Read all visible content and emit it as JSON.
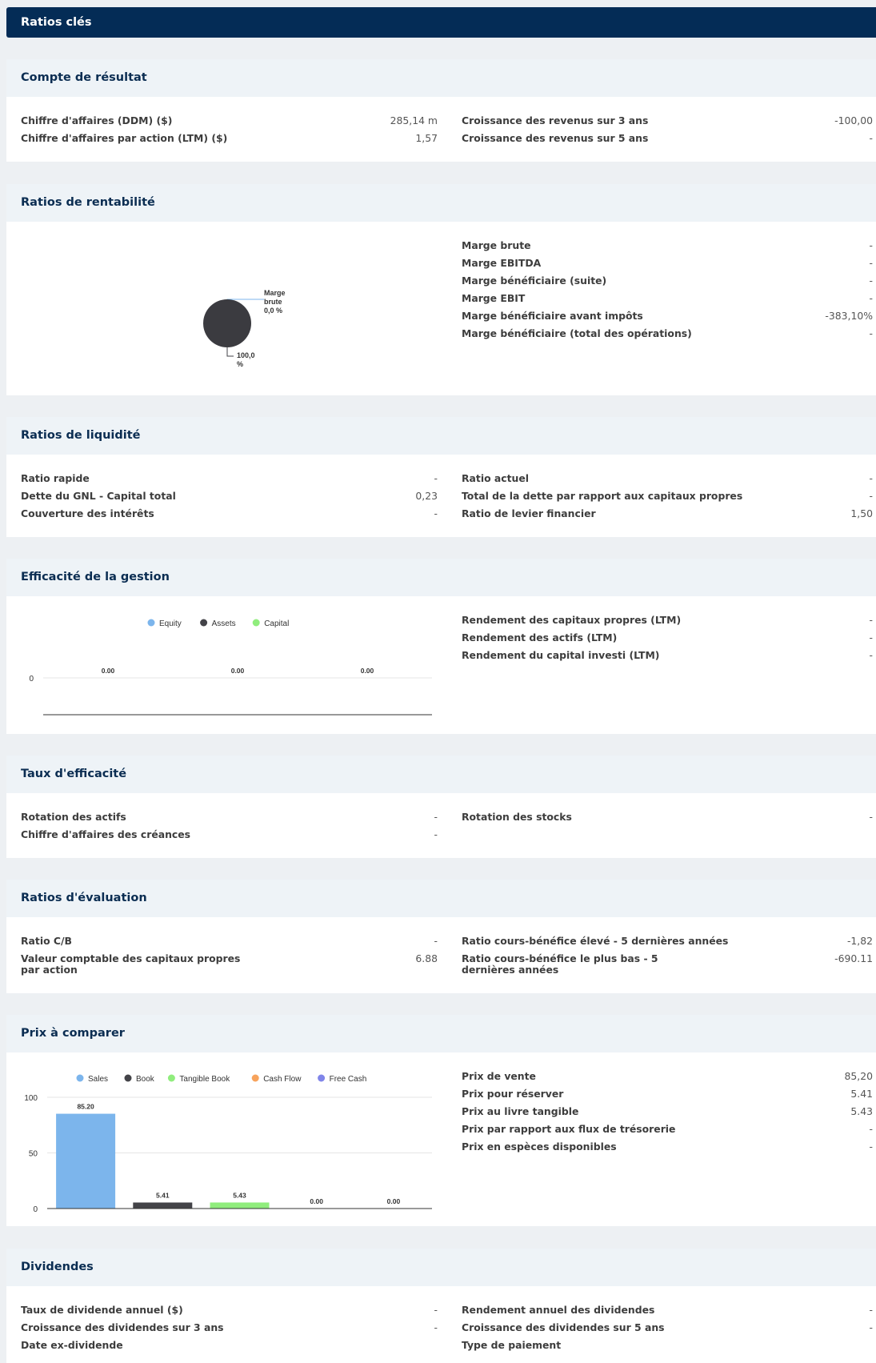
{
  "header": {
    "title": "Ratios clés"
  },
  "income": {
    "title": "Compte de résultat",
    "left": [
      {
        "label": "Chiffre d'affaires (DDM) ($)",
        "value": "285,14 m"
      },
      {
        "label": "Chiffre d'affaires par action (LTM) ($)",
        "value": "1,57"
      }
    ],
    "right": [
      {
        "label": "Croissance des revenus sur 3 ans",
        "value": "-100,00"
      },
      {
        "label": "Croissance des revenus sur 5 ans",
        "value": "-"
      }
    ]
  },
  "profitability": {
    "title": "Ratios de rentabilité",
    "pie_label_top": [
      "Marge",
      "brute",
      "0,0 %"
    ],
    "pie_label_bottom": [
      "100,0",
      "%"
    ],
    "right": [
      {
        "label": "Marge brute",
        "value": "-"
      },
      {
        "label": "Marge EBITDA",
        "value": "-"
      },
      {
        "label": "Marge bénéficiaire (suite)",
        "value": "-"
      },
      {
        "label": "Marge EBIT",
        "value": "-"
      },
      {
        "label": "Marge bénéficiaire avant impôts",
        "value": "-383,10%"
      },
      {
        "label": "Marge bénéficiaire (total des opérations)",
        "value": "-"
      }
    ]
  },
  "liquidity": {
    "title": "Ratios de liquidité",
    "left": [
      {
        "label": "Ratio rapide",
        "value": "-"
      },
      {
        "label": "Dette du GNL - Capital total",
        "value": "0,23"
      },
      {
        "label": "Couverture des intérêts",
        "value": "-"
      }
    ],
    "right": [
      {
        "label": "Ratio actuel",
        "value": "-"
      },
      {
        "label": "Total de la dette par rapport aux capitaux propres",
        "value": "-"
      },
      {
        "label": "Ratio de levier financier",
        "value": "1,50"
      }
    ]
  },
  "management": {
    "title": "Efficacité de la gestion",
    "right": [
      {
        "label": "Rendement des capitaux propres (LTM)",
        "value": "-"
      },
      {
        "label": "Rendement des actifs (LTM)",
        "value": "-"
      },
      {
        "label": "Rendement du capital investi (LTM)",
        "value": "-"
      }
    ]
  },
  "efficiency": {
    "title": "Taux d'efficacité",
    "left": [
      {
        "label": "Rotation des actifs",
        "value": "-"
      },
      {
        "label": "Chiffre d'affaires des créances",
        "value": "-"
      }
    ],
    "right": [
      {
        "label": "Rotation des stocks",
        "value": "-"
      }
    ]
  },
  "valuation": {
    "title": "Ratios d'évaluation",
    "left": [
      {
        "label": "Ratio C/B",
        "value": "-"
      },
      {
        "label": "Valeur comptable des capitaux propres par action",
        "value": "6.88"
      }
    ],
    "right": [
      {
        "label": "Ratio cours-bénéfice élevé - 5 dernières années",
        "value": "-1,82"
      },
      {
        "label": "Ratio cours-bénéfice le plus bas - 5 dernières années",
        "value": "-690.11"
      }
    ]
  },
  "prices": {
    "title": "Prix à comparer",
    "right": [
      {
        "label": "Prix de vente",
        "value": "85,20"
      },
      {
        "label": "Prix pour réserver",
        "value": "5.41"
      },
      {
        "label": "Prix au livre tangible",
        "value": "5.43"
      },
      {
        "label": "Prix par rapport aux flux de trésorerie",
        "value": "-"
      },
      {
        "label": "Prix en espèces disponibles",
        "value": "-"
      }
    ]
  },
  "dividends": {
    "title": "Dividendes",
    "left": [
      {
        "label": "Taux de dividende annuel ($)",
        "value": "-"
      },
      {
        "label": "Croissance des dividendes sur 3 ans",
        "value": "-"
      },
      {
        "label": "Date ex-dividende",
        "value": ""
      }
    ],
    "right": [
      {
        "label": "Rendement annuel des dividendes",
        "value": "-"
      },
      {
        "label": "Croissance des dividendes sur 5 ans",
        "value": "-"
      },
      {
        "label": "Type de paiement",
        "value": ""
      }
    ]
  },
  "chart_data": [
    {
      "type": "pie",
      "slices": [
        {
          "label": "Marge brute",
          "value": 0.0
        },
        {
          "label": "",
          "value": 100.0
        }
      ],
      "colors": [
        "#3b3b40"
      ]
    },
    {
      "type": "bar",
      "legend": [
        "Equity",
        "Assets",
        "Capital"
      ],
      "colors": [
        "#7cb5ec",
        "#434348",
        "#90ed7d"
      ],
      "values": [
        0.0,
        0.0,
        0.0
      ],
      "value_labels": [
        "0.00",
        "0.00",
        "0.00"
      ],
      "yticks": [
        "0"
      ],
      "ylim": [
        0,
        1
      ]
    },
    {
      "type": "bar",
      "legend": [
        "Sales",
        "Book",
        "Tangible Book",
        "Cash Flow",
        "Free Cash"
      ],
      "colors": [
        "#7cb5ec",
        "#434348",
        "#90ed7d",
        "#f7a35c",
        "#8085e9"
      ],
      "values": [
        85.2,
        5.41,
        5.43,
        0.0,
        0.0
      ],
      "value_labels": [
        "85.20",
        "5.41",
        "5.43",
        "0.00",
        "0.00"
      ],
      "yticks": [
        "0",
        "50",
        "100"
      ],
      "ylim": [
        0,
        100
      ],
      "grid": true
    }
  ]
}
